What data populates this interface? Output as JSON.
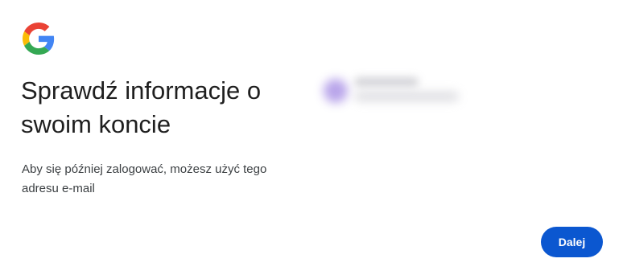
{
  "logo": {
    "icon": "google-g-icon",
    "colors": [
      "#4285F4",
      "#34A853",
      "#FBBC05",
      "#EA4335"
    ]
  },
  "header": {
    "title": "Sprawdź informacje o swoim koncie",
    "subtitle": "Aby się później zalogować, możesz użyć tego adresu e-mail"
  },
  "account": {
    "avatar_color": "#b19be8"
  },
  "actions": {
    "next_label": "Dalej",
    "accent": "#0b57d0"
  }
}
